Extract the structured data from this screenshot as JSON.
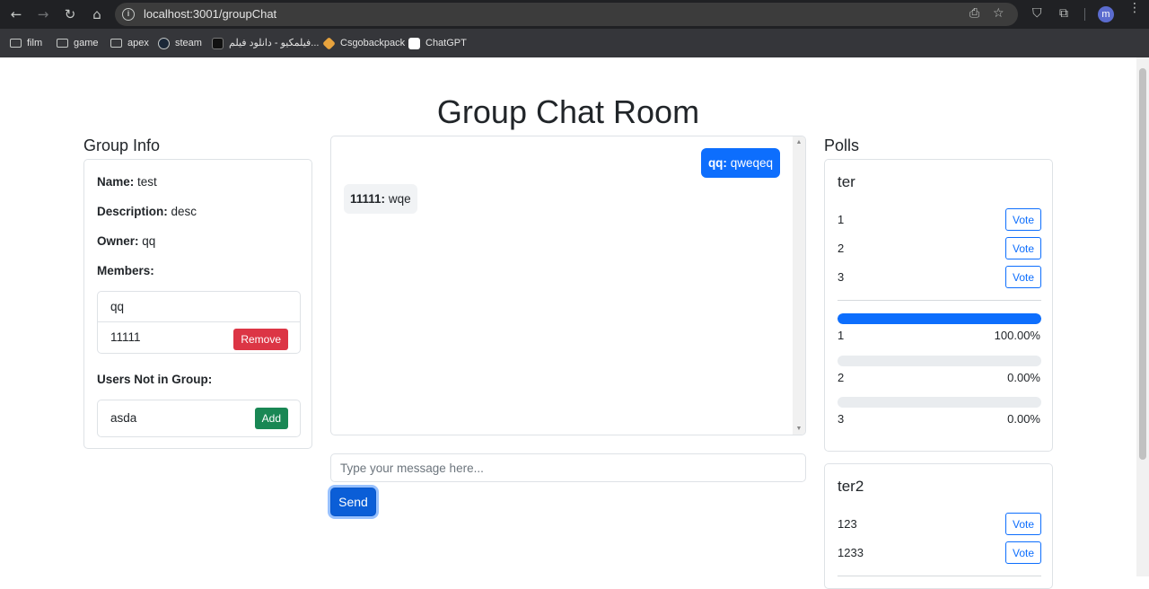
{
  "browser": {
    "url": "localhost:3001/groupChat",
    "profile_initial": "m",
    "bookmarks": [
      {
        "label": "film",
        "icon": "folder-icon"
      },
      {
        "label": "game",
        "icon": "folder-icon"
      },
      {
        "label": "apex",
        "icon": "folder-icon"
      },
      {
        "label": "steam",
        "icon": "steam-icon"
      },
      {
        "label": "فیلمکیو - دانلود فیلم...",
        "icon": "filmkio-icon"
      },
      {
        "label": "Csgobackpack",
        "icon": "csgobackpack-icon"
      },
      {
        "label": "ChatGPT",
        "icon": "chatgpt-icon"
      }
    ]
  },
  "page": {
    "title": "Group Chat Room"
  },
  "group_info": {
    "heading": "Group Info",
    "name_label": "Name:",
    "name_value": "test",
    "description_label": "Description:",
    "description_value": "desc",
    "owner_label": "Owner:",
    "owner_value": "qq",
    "members_label": "Members:",
    "members": [
      {
        "name": "qq"
      },
      {
        "name": "11111",
        "action": "Remove"
      }
    ],
    "not_in_group_label": "Users Not in Group:",
    "not_in_group": [
      {
        "name": "asda",
        "action": "Add"
      }
    ]
  },
  "chat": {
    "messages": [
      {
        "sender": "qq:",
        "text": "qweqeq",
        "own": true
      },
      {
        "sender": "11111:",
        "text": "wqe",
        "own": false
      }
    ],
    "input_placeholder": "Type your message here...",
    "send_label": "Send"
  },
  "polls": {
    "heading": "Polls",
    "items": [
      {
        "question": "ter",
        "vote_label": "Vote",
        "options": [
          "1",
          "2",
          "3"
        ],
        "results": [
          {
            "label": "1",
            "fraction": 1.0,
            "percent": "100.00%"
          },
          {
            "label": "2",
            "fraction": 0.0,
            "percent": "0.00%"
          },
          {
            "label": "3",
            "fraction": 0.0,
            "percent": "0.00%"
          }
        ]
      },
      {
        "question": "ter2",
        "vote_label": "Vote",
        "options": [
          "123",
          "1233"
        ]
      }
    ]
  },
  "colors": {
    "primary": "#0d6efd",
    "danger": "#dc3545",
    "success": "#198754"
  }
}
